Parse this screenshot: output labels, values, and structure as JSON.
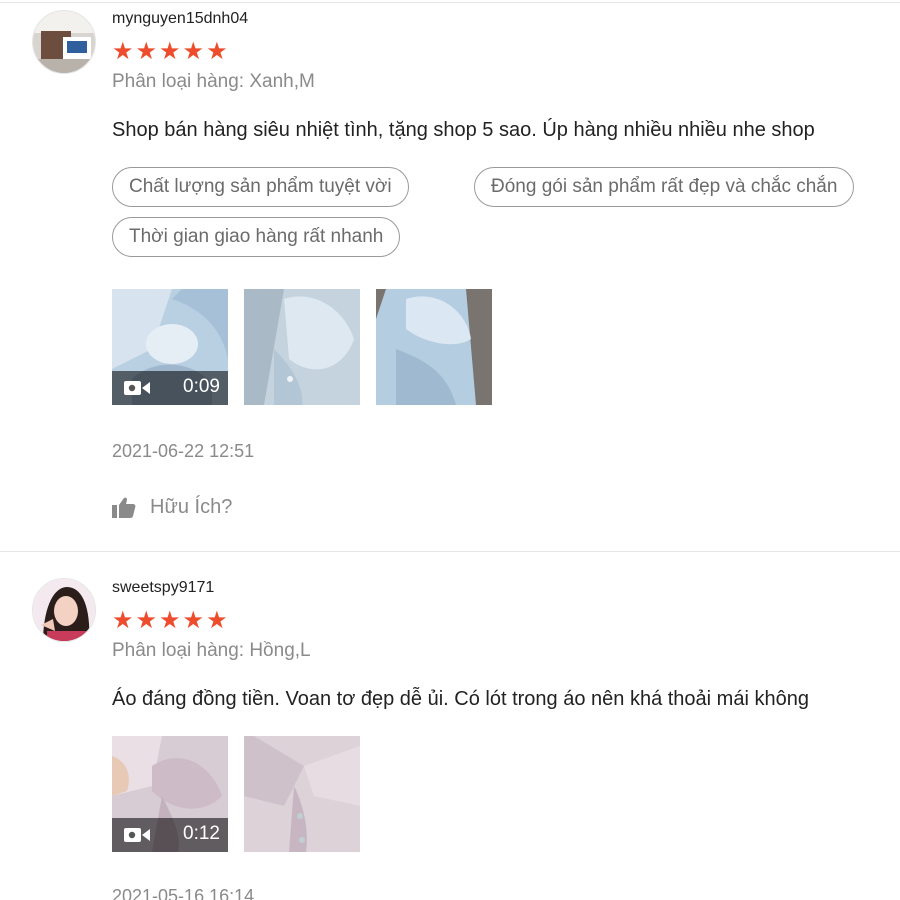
{
  "reviews": [
    {
      "username": "mynguyen15dnh04",
      "rating": 5,
      "variation": "Phân loại hàng: Xanh,M",
      "comment": "Shop bán hàng siêu nhiệt tình, tặng shop 5 sao. Úp hàng nhiều nhiều nhe shop",
      "tags": [
        "Chất lượng sản phẩm tuyệt vời",
        "Đóng gói sản phẩm rất đẹp và chắc chắn",
        "Thời gian giao hàng rất nhanh"
      ],
      "media": [
        {
          "type": "video",
          "duration": "0:09",
          "icon": "video-camera-icon",
          "tone": "light-blue"
        },
        {
          "type": "image",
          "tone": "light-blue"
        },
        {
          "type": "image",
          "tone": "light-blue"
        }
      ],
      "timestamp": "2021-06-22 12:51",
      "helpful_label": "Hữu Ích?"
    },
    {
      "username": "sweetspy9171",
      "rating": 5,
      "variation": "Phân loại hàng: Hồng,L",
      "comment": "Áo đáng đồng tiền. Voan tơ đẹp dễ ủi. Có lót trong áo nên khá thoải mái không",
      "media": [
        {
          "type": "video",
          "duration": "0:12",
          "icon": "video-camera-icon",
          "tone": "light-pink"
        },
        {
          "type": "image",
          "tone": "light-pink"
        }
      ],
      "timestamp": "2021-05-16 16:14"
    }
  ],
  "colors": {
    "star": "#ee4d2d",
    "muted_text": "#8a8a8a",
    "divider": "#e6e6e6"
  }
}
